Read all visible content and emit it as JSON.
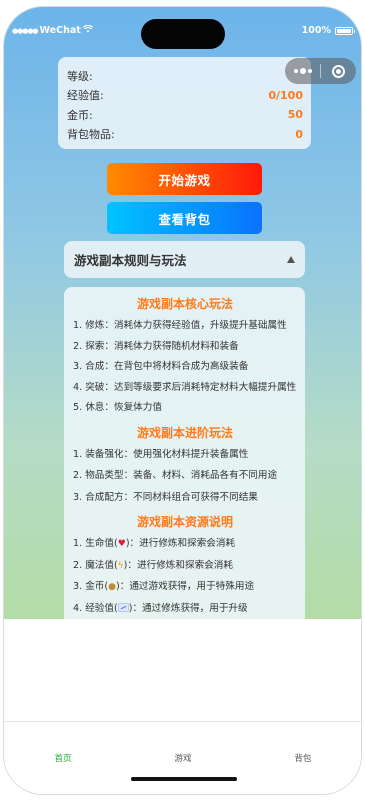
{
  "status_bar": {
    "carrier": "WeChat",
    "battery": "100%"
  },
  "stats": [
    {
      "label": "等级:",
      "value": ""
    },
    {
      "label": "经验值:",
      "value": "0/100"
    },
    {
      "label": "金币:",
      "value": "50"
    },
    {
      "label": "背包物品:",
      "value": "0"
    }
  ],
  "buttons": {
    "start": "开始游戏",
    "bag": "查看背包"
  },
  "rules": {
    "header": "游戏副本规则与玩法",
    "core_title": "游戏副本核心玩法",
    "core_items": [
      "1. 修炼：消耗体力获得经验值，升级提升基础属性",
      "2. 探索：消耗体力获得随机材料和装备",
      "3. 合成：在背包中将材料合成为高级装备",
      "4. 突破：达到等级要求后消耗特定材料大幅提升属性",
      "5. 休息：恢复体力值"
    ],
    "adv_title": "游戏副本进阶玩法",
    "adv_items": [
      "1. 装备强化：使用强化材料提升装备属性",
      "2. 物品类型：装备、材料、消耗品各有不同用途",
      "3. 合成配方：不同材料组合可获得不同结果"
    ],
    "res_title": "游戏副本资源说明",
    "res_items": [
      {
        "pre": "1. 生命值(",
        "icon": "heart-icon",
        "post": ")：进行修炼和探索会消耗"
      },
      {
        "pre": "2. 魔法值(",
        "icon": "lightning-icon",
        "post": ")：进行修炼和探索会消耗"
      },
      {
        "pre": "3. 金币(",
        "icon": "money-bag-icon",
        "post": ")：通过游戏获得，用于特殊用途"
      },
      {
        "pre": "4. 经验值(",
        "icon": "chart-icon",
        "post": ")：通过修炼获得，用于升级"
      }
    ]
  },
  "tabs": [
    {
      "label": "首页",
      "active": true
    },
    {
      "label": "游戏",
      "active": false
    },
    {
      "label": "背包",
      "active": false
    }
  ],
  "colors": {
    "accent": "#ff7a1a",
    "tab_active": "#1fae3c"
  }
}
